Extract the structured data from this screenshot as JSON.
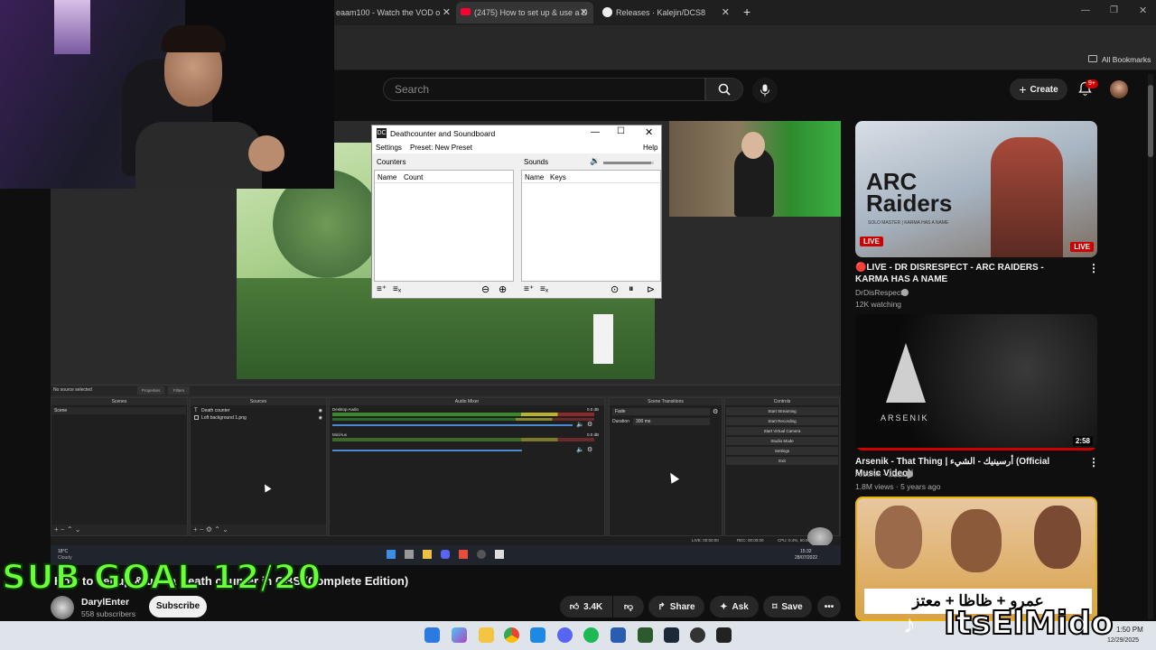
{
  "browser": {
    "tabs": [
      {
        "label": "eaam100 - Watch the VOD o",
        "active": false
      },
      {
        "label": "(2475) How to set up & use a D",
        "active": true
      },
      {
        "label": "Releases · Kalejin/DCS8",
        "active": false
      }
    ],
    "new_tab": "+",
    "bookmarks_label": "All Bookmarks"
  },
  "youtube": {
    "search_placeholder": "Search",
    "create_label": "Create",
    "notification_count": "9+"
  },
  "obs": {
    "source_status": "No source selected",
    "properties_label": "Properties",
    "filters_label": "Filters",
    "docks": {
      "scenes": "Scenes",
      "sources": "Sources",
      "audio_mixer": "Audio Mixer",
      "transitions": "Scene Transitions",
      "controls": "Controls"
    },
    "scene_item": "Scene",
    "source_items": [
      "Death counter",
      "Loft background 1.png"
    ],
    "audio_channels": [
      {
        "name": "Desktop Audio",
        "db": "0.0 dB"
      },
      {
        "name": "Mic/Aux",
        "db": "0.0 dB"
      }
    ],
    "transition": {
      "type": "Fade",
      "duration_label": "Duration",
      "duration": "300 ms"
    },
    "control_buttons": [
      "Start Streaming",
      "Start Recording",
      "Start Virtual Camera",
      "Studio Mode",
      "Settings",
      "Exit"
    ],
    "statusbar": {
      "live": "LIVE: 00:00:00",
      "rec": "REC: 00:00:00",
      "cpu": "CPU: 0.4%, 60.00 fps"
    },
    "weather": {
      "temp": "18°C",
      "condition": "Cloudy"
    },
    "vm_clock": {
      "time": "15:32",
      "date": "28/07/2022"
    }
  },
  "deathcounter": {
    "title": "Deathcounter and Soundboard",
    "menu": {
      "settings": "Settings",
      "preset": "Preset: New Preset",
      "help": "Help"
    },
    "counters_label": "Counters",
    "sounds_label": "Sounds",
    "counters_columns": [
      "Name",
      "Count"
    ],
    "sounds_columns": [
      "Name",
      "Keys"
    ],
    "volume_level": 0.95
  },
  "video": {
    "title": "How to set up & use a Death counter in OBS (Complete Edition)",
    "channel": "DarylEnter",
    "subscribers": "558 subscribers",
    "subscribe_label": "Subscribe",
    "likes": "3.4K",
    "share_label": "Share",
    "ask_label": "Ask",
    "save_label": "Save"
  },
  "sidebar": [
    {
      "title": "🔴LIVE - DR DISRESPECT - ARC RAIDERS - KARMA HAS A NAME",
      "channel": "DrDisRespect",
      "meta": "12K watching",
      "badge_left": "LIVE",
      "badge_right": "LIVE",
      "thumb_text": "ARC Raiders",
      "thumb_sub": "SOLO MASTER | KARMA HAS A NAME"
    },
    {
      "title": "Arsenik - That Thing | أرسينيك - الشيء (Official Music Video)",
      "channel": "Arsenik - أرسينيك",
      "meta": "1.8M views · 5 years ago",
      "duration": "2:58",
      "thumb_text": "ARSENIK"
    },
    {
      "thumb_text": "عمرو + ظاظا + معتز"
    }
  ],
  "overlay": {
    "sub_goal": "SUB GOAL 12/20",
    "streamer": "ItsElMido"
  },
  "taskbar": {
    "time": "1:50 PM",
    "date": "12/29/2025"
  },
  "colors": {
    "yt_bg": "#0f0f0f",
    "notification_red": "#cc0000",
    "subgoal_green": "#6bff3a",
    "live_red": "#cc0000"
  }
}
